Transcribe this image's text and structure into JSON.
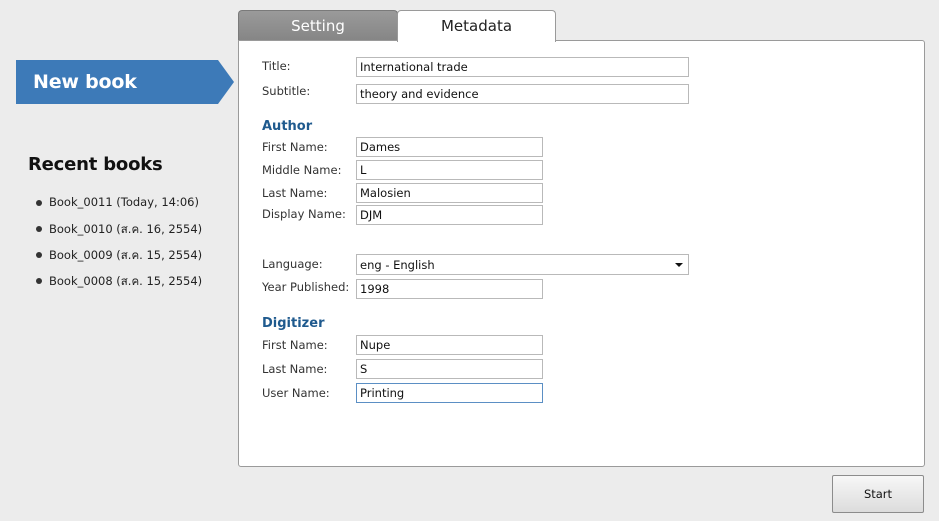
{
  "sidebar": {
    "new_book_label": "New book",
    "recent_title": "Recent books",
    "recent_items": [
      "Book_0011 (Today, 14:06)",
      "Book_0010 (ส.ค. 16, 2554)",
      "Book_0009 (ส.ค. 15, 2554)",
      "Book_0008 (ส.ค. 15, 2554)"
    ]
  },
  "tabs": {
    "setting": "Setting",
    "metadata": "Metadata",
    "active": "metadata"
  },
  "form": {
    "title_label": "Title:",
    "title_value": "International trade",
    "subtitle_label": "Subtitle:",
    "subtitle_value": "theory and evidence",
    "author": {
      "heading": "Author",
      "first_name_label": "First Name:",
      "first_name_value": "Dames",
      "middle_name_label": "Middle Name:",
      "middle_name_value": "L",
      "last_name_label": "Last Name:",
      "last_name_value": "Malosien",
      "display_name_label": "Display Name:",
      "display_name_value": "DJM"
    },
    "language_label": "Language:",
    "language_value": "eng - English",
    "year_label": "Year Published:",
    "year_value": "1998",
    "digitizer": {
      "heading": "Digitizer",
      "first_name_label": "First Name:",
      "first_name_value": "Nupe",
      "last_name_label": "Last Name:",
      "last_name_value": "S",
      "user_name_label": "User Name:",
      "user_name_value": "Printing"
    }
  },
  "actions": {
    "start_label": "Start"
  },
  "colors": {
    "accent": "#3d7ab8",
    "section_heading": "#1f5a8e",
    "tab_inactive": "#8e8e8e"
  }
}
